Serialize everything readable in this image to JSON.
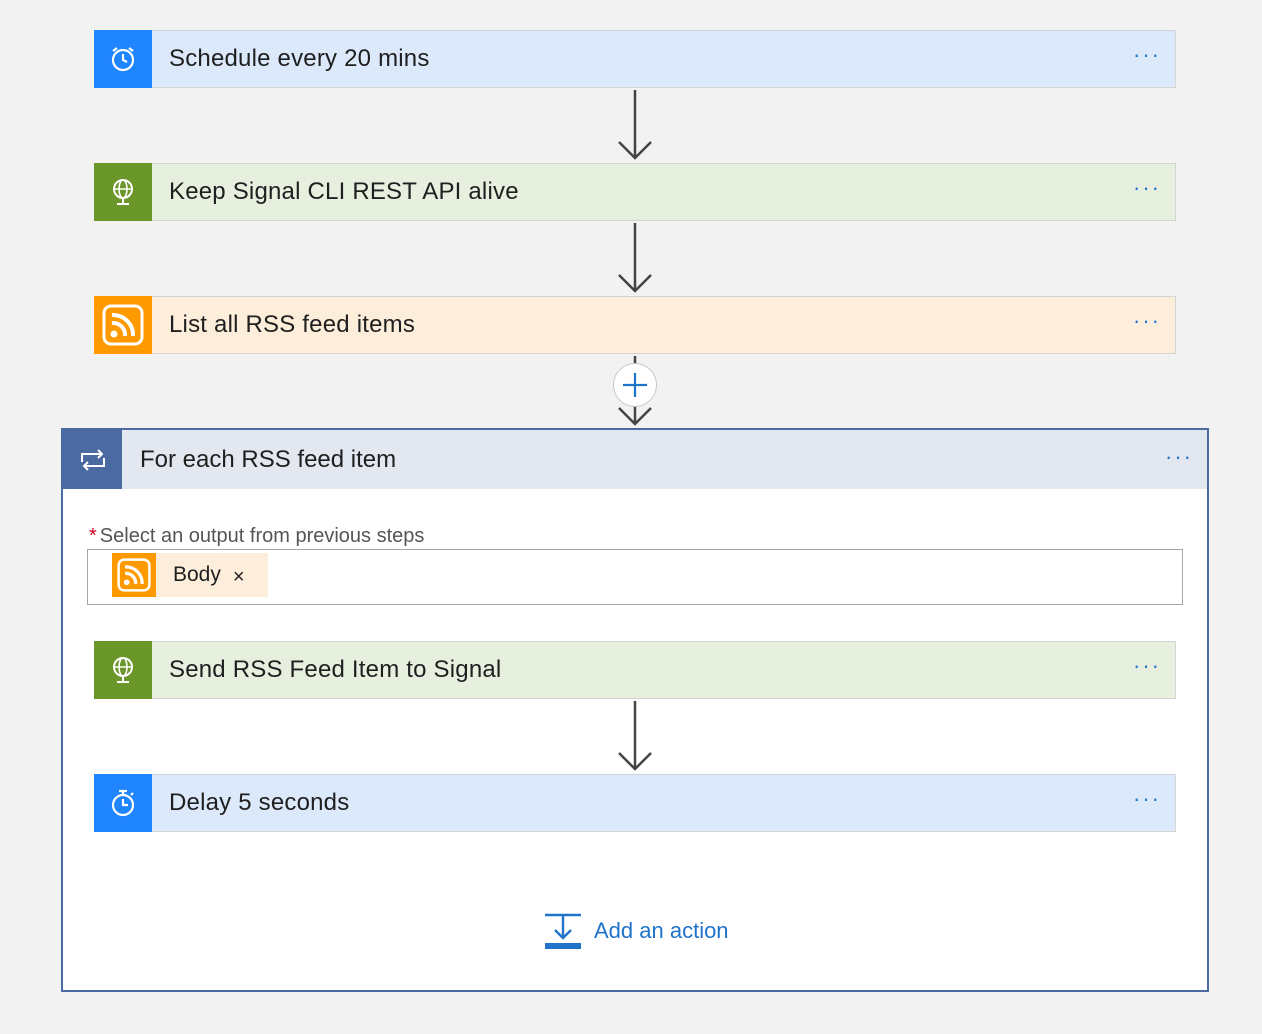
{
  "steps": [
    {
      "title": "Schedule every 20 mins",
      "icon": "alarm-clock-icon",
      "color": "#1f85ff"
    },
    {
      "title": "Keep Signal CLI REST API alive",
      "icon": "globe-icon",
      "color": "#6b962a"
    },
    {
      "title": "List all RSS feed items",
      "icon": "rss-icon",
      "color": "#ff9900"
    }
  ],
  "more_label": "···",
  "loop": {
    "title": "For each RSS feed item",
    "icon": "loop-icon",
    "field_label": "Select an output from previous steps",
    "required_mark": "*",
    "token": {
      "label": "Body",
      "remove": "×",
      "icon": "rss-icon"
    },
    "steps": [
      {
        "title": "Send RSS Feed Item to Signal",
        "icon": "globe-icon",
        "color": "#6b962a"
      },
      {
        "title": "Delay 5 seconds",
        "icon": "timer-icon",
        "color": "#1f85ff"
      }
    ],
    "add_action_label": "Add an action"
  }
}
